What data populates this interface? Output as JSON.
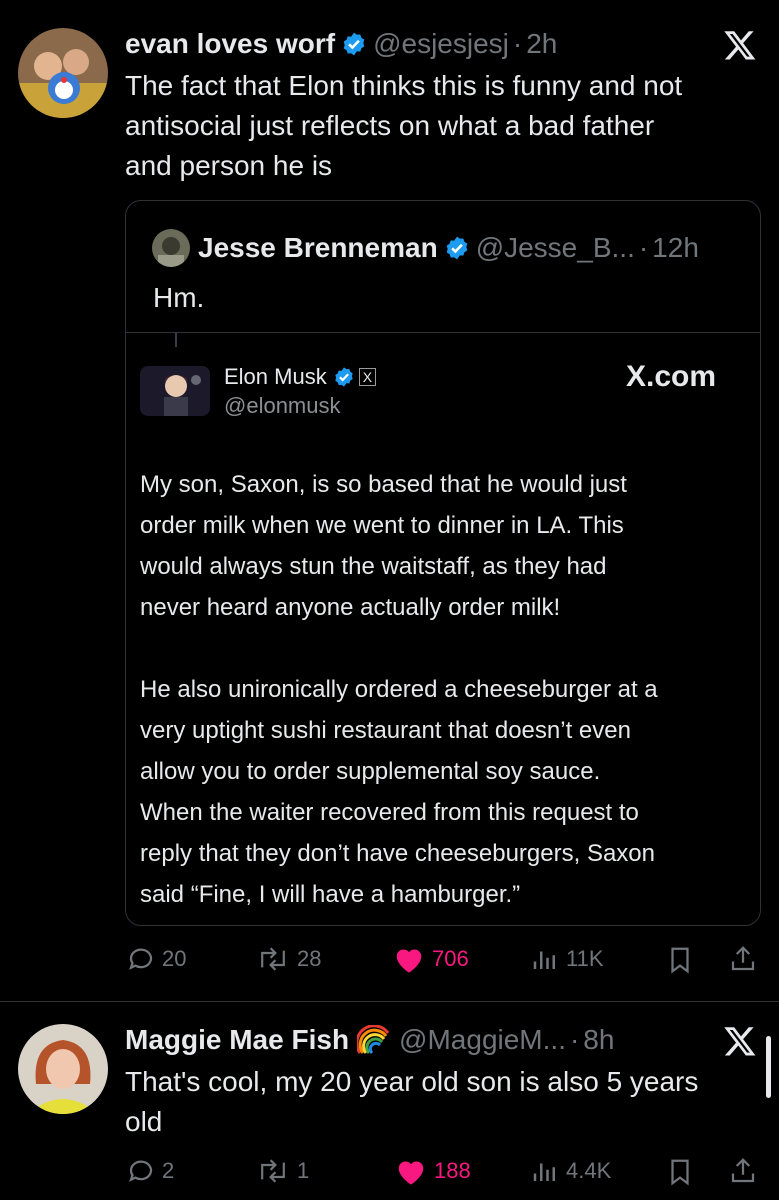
{
  "tweet1": {
    "display_name": "evan loves worf",
    "handle": "@esjesjesj",
    "separator": "·",
    "time": "2h",
    "text_line1": "The fact that Elon thinks this is funny and not",
    "text_line2": "antisocial just reflects on what a bad father",
    "text_line3": "and person he is",
    "quote": {
      "display_name": "Jesse Brenneman",
      "handle": "@Jesse_B...",
      "separator": "·",
      "time": "12h",
      "text": "Hm.",
      "embedded": {
        "display_name": "Elon Musk",
        "badge": "X",
        "handle": "@elonmusk",
        "site": "X.com",
        "lines": [
          "My son, Saxon, is so based that he would just",
          "order milk when we went to dinner in LA. This",
          "would always stun the waitstaff, as they had",
          "never heard anyone actually order milk!",
          "",
          "He also unironically ordered a cheeseburger at a",
          "very uptight sushi restaurant that doesn’t even",
          "allow you to order supplemental soy sauce.",
          "When the waiter recovered from this request to",
          "reply that they don’t have cheeseburgers, Saxon",
          "said “Fine, I will have a hamburger.”"
        ]
      }
    },
    "actions": {
      "replies": "20",
      "reposts": "28",
      "likes": "706",
      "views": "11K"
    }
  },
  "tweet2": {
    "display_name": "Maggie Mae Fish",
    "handle": "@MaggieM...",
    "separator": "·",
    "time": "8h",
    "text_line1": "That's cool, my 20 year old son is also 5 years",
    "text_line2": "old",
    "actions": {
      "replies": "2",
      "reposts": "1",
      "likes": "188",
      "views": "4.4K"
    }
  },
  "colors": {
    "background": "#000000",
    "text": "#e7e9ea",
    "muted": "#71767b",
    "like": "#f91880",
    "verified": "#1d9bf0",
    "border": "#2f3336"
  }
}
